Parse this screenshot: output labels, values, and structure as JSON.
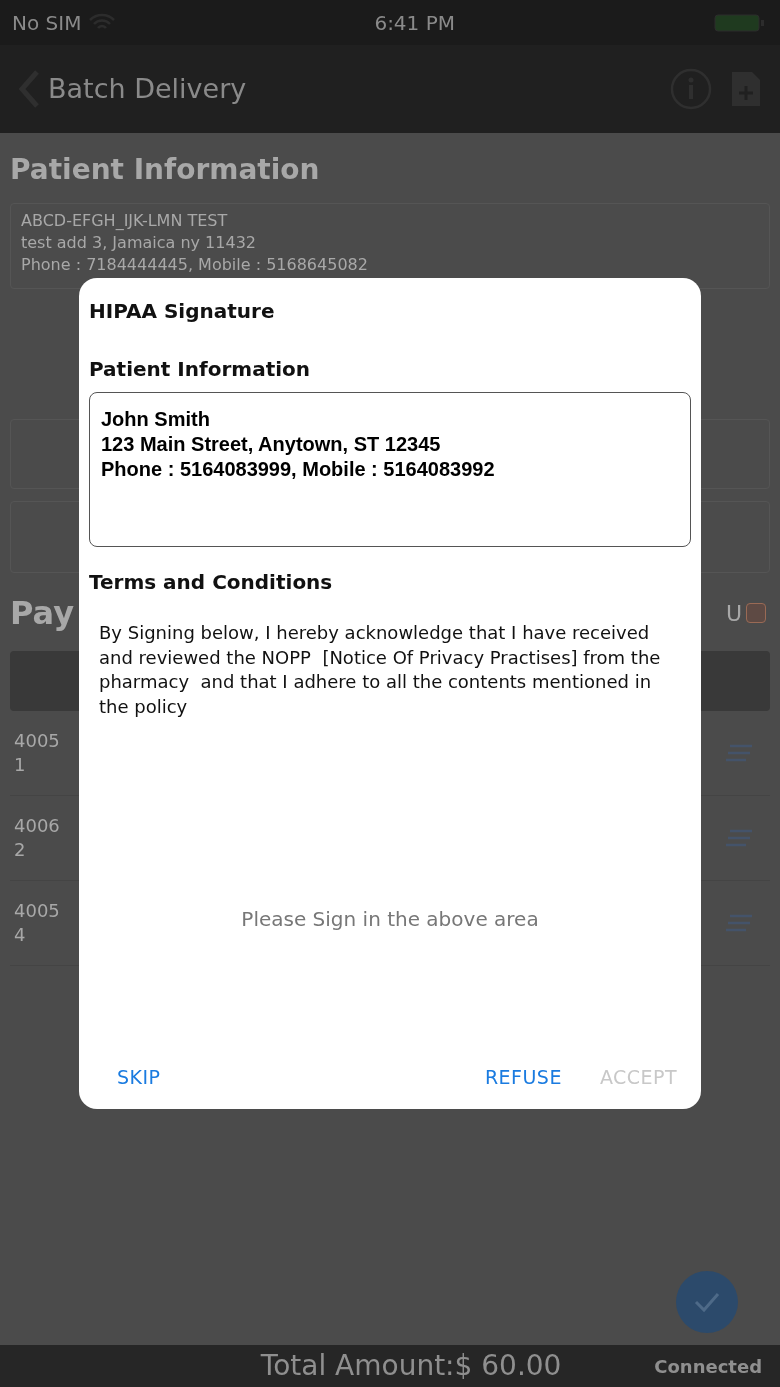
{
  "status_bar": {
    "carrier": "No SIM",
    "time": "6:41 PM"
  },
  "nav": {
    "title": "Batch Delivery"
  },
  "background": {
    "section_title": "Patient Information",
    "patient_lines": [
      "ABCD-EFGH_IJK-LMN TEST",
      "test add 3, Jamaica ny 11432",
      "Phone : 7184444445, Mobile : 5168645082"
    ],
    "payment_title": "Pay",
    "toggle_label": "U",
    "toggle_checked": false,
    "rows": [
      {
        "column_1": [
          "4005",
          "1"
        ]
      },
      {
        "column_1": [
          "4006",
          "2"
        ]
      },
      {
        "column_1": [
          "4005",
          "4"
        ]
      }
    ]
  },
  "footer": {
    "total": "Total Amount:$ 60.00",
    "connection": "Connected"
  },
  "dialog": {
    "title": "HIPAA Signature",
    "patient_heading": "Patient Information",
    "patient_lines": [
      "John Smith",
      "123 Main Street, Anytown, ST 12345",
      "Phone : 5164083999, Mobile : 5164083992"
    ],
    "terms_heading": "Terms and Conditions",
    "terms_text": "By Signing below, I hereby acknowledge that I have received and reviewed the NOPP  [Notice Of Privacy Practises] from the pharmacy  and that I adhere to all the contents mentioned in the policy",
    "signature_hint": "Please Sign in the above area",
    "buttons": [
      {
        "label": "SKIP",
        "disabled": false
      },
      {
        "label": "REFUSE",
        "disabled": false
      },
      {
        "label": "ACCEPT",
        "disabled": true
      }
    ]
  }
}
